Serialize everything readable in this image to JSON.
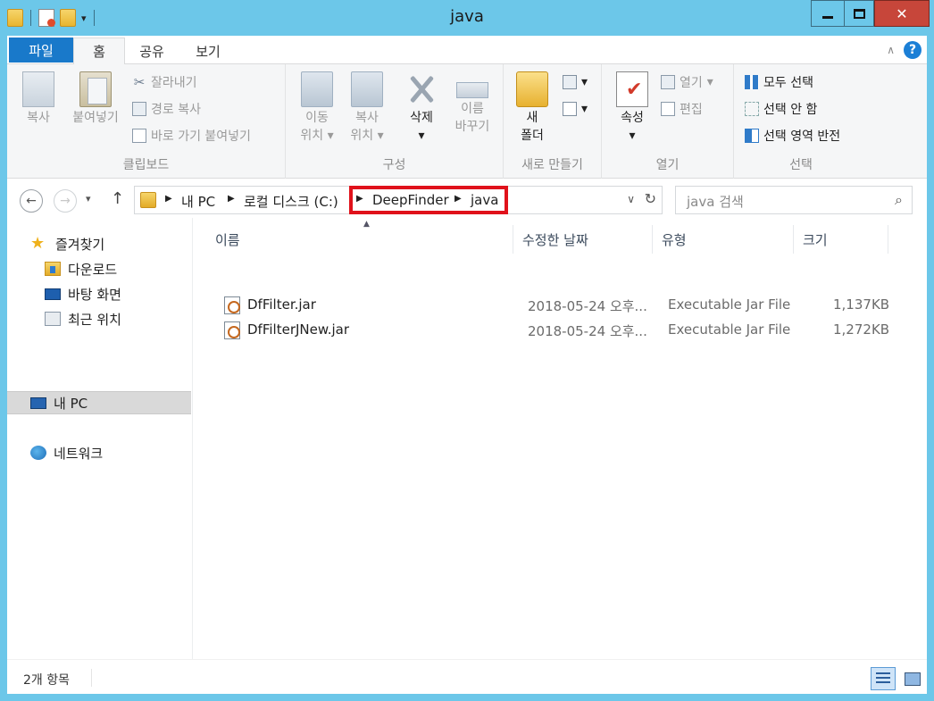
{
  "window": {
    "title": "java"
  },
  "ribbon_tabs": [
    {
      "label": "파일"
    },
    {
      "label": "홈"
    },
    {
      "label": "공유"
    },
    {
      "label": "보기"
    }
  ],
  "ribbon": {
    "clipboard": {
      "label": "클립보드",
      "copy": "복사",
      "paste": "붙여넣기",
      "cut": "잘라내기",
      "copy_path": "경로 복사",
      "paste_shortcut": "바로 가기 붙여넣기"
    },
    "organize": {
      "label": "구성",
      "move_to_l1": "이동",
      "move_to_l2": "위치",
      "copy_to_l1": "복사",
      "copy_to_l2": "위치",
      "delete": "삭제",
      "rename_l1": "이름",
      "rename_l2": "바꾸기"
    },
    "new": {
      "label": "새로 만들기",
      "new_folder_l1": "새",
      "new_folder_l2": "폴더"
    },
    "open": {
      "label": "열기",
      "properties": "속성",
      "open": "열기",
      "edit": "편집"
    },
    "select": {
      "label": "선택",
      "select_all": "모두 선택",
      "select_none": "선택 안 함",
      "invert": "선택 영역 반전"
    }
  },
  "address": {
    "crumbs": [
      "내 PC",
      "로컬 디스크 (C:)",
      "DeepFinder",
      "java"
    ]
  },
  "search": {
    "placeholder": "java 검색"
  },
  "nav_pane": {
    "favorites": "즐겨찾기",
    "downloads": "다운로드",
    "desktop": "바탕 화면",
    "recent": "최근 위치",
    "this_pc": "내 PC",
    "network": "네트워크"
  },
  "columns": {
    "name": "이름",
    "date": "수정한 날짜",
    "type": "유형",
    "size": "크기"
  },
  "files": [
    {
      "name": "DfFilter.jar",
      "date": "2018-05-24 오후...",
      "type": "Executable Jar File",
      "size": "1,137KB"
    },
    {
      "name": "DfFilterJNew.jar",
      "date": "2018-05-24 오후...",
      "type": "Executable Jar File",
      "size": "1,272KB"
    }
  ],
  "status": {
    "count": "2개 항목"
  }
}
